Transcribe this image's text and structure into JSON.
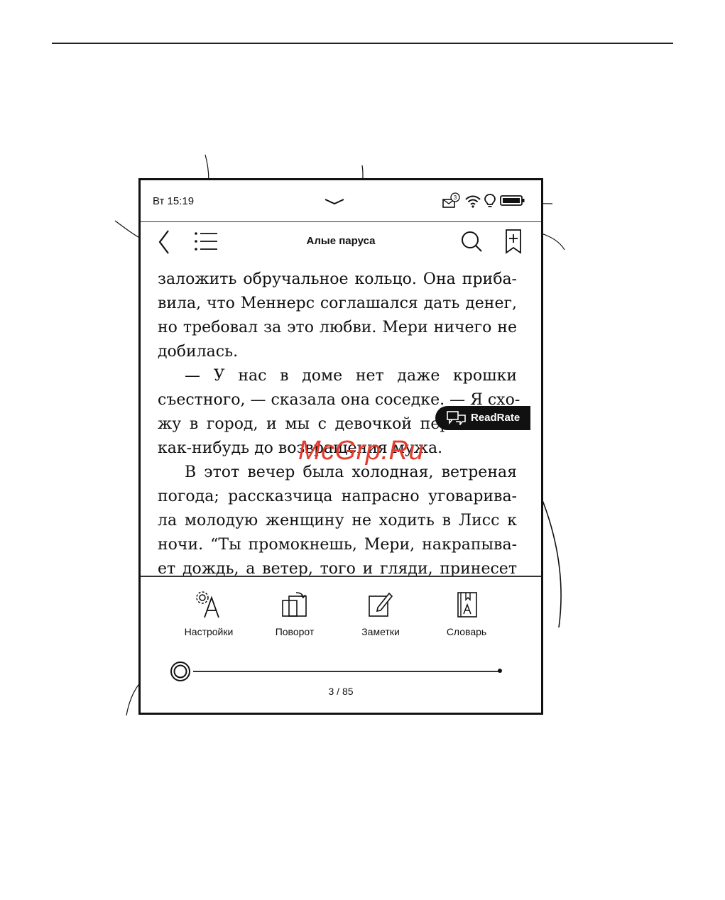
{
  "status_bar": {
    "time": "Вт 15:19",
    "mail_badge": "3"
  },
  "toolbar": {
    "title": "Алые паруса"
  },
  "book_text": {
    "lines": [
      "заложить обручальное кольцо. Она прибa-",
      "вила, что Меннерс соглашался дать денег,",
      "но требовал за это любви. Мери ничего не",
      "добилась.",
      "— У нас в доме нет даже крошки",
      "съестного, — сказала она соседке. — Я схо-",
      "жу в город, и мы с девочкой перебьемся",
      "как-нибудь до возвращения мужа.",
      "В этот вечер была холодная, ветреная",
      "погода; рассказчица напрасно уговарива-",
      "ла молодую женщину не ходить в Лисс к",
      "ночи. “Ты промокнешь, Мери, накрапыва-",
      "ет дождь, а ветер, того и гляди, принесет"
    ]
  },
  "readrate": {
    "label": "ReadRate"
  },
  "bottom_menu": {
    "items": [
      {
        "label": "Настройки",
        "icon": "settings-font-icon"
      },
      {
        "label": "Поворот",
        "icon": "rotate-icon"
      },
      {
        "label": "Заметки",
        "icon": "notes-icon"
      },
      {
        "label": "Словарь",
        "icon": "dictionary-icon"
      }
    ]
  },
  "progress": {
    "page_label": "3 / 85",
    "current_page": 3,
    "total_pages": 85
  },
  "watermark": {
    "text": "McGrp.Ru"
  },
  "colors": {
    "watermark": "#e53b2e",
    "ink": "#111111",
    "readrate_bg": "#111111"
  }
}
